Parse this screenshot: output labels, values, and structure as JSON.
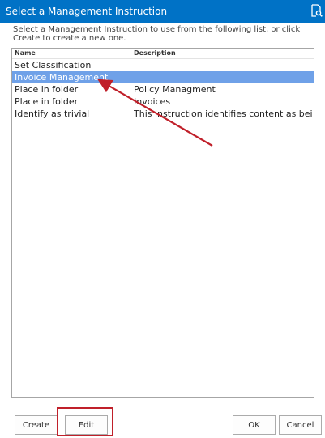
{
  "dialog": {
    "title": "Select a Management Instruction",
    "instruction": "Select a Management Instruction to use from the following list, or click Create to create a new one."
  },
  "list": {
    "columns": [
      "Name",
      "Description"
    ],
    "rows": [
      {
        "name": "Set Classification",
        "description": "",
        "selected": false
      },
      {
        "name": "Invoice Management",
        "description": "",
        "selected": true
      },
      {
        "name": "Place in folder",
        "description": "Policy Managment",
        "selected": false
      },
      {
        "name": "Place in folder",
        "description": "Invoices",
        "selected": false
      },
      {
        "name": "Identify as trivial",
        "description": "This instruction identifies content as being ...",
        "selected": false
      }
    ]
  },
  "buttons": {
    "create": "Create",
    "edit": "Edit",
    "ok": "OK",
    "cancel": "Cancel"
  },
  "colors": {
    "titlebar": "#0072c6",
    "selection": "#6fa1e8",
    "annotation": "#c0202a"
  },
  "icons": {
    "titlebar": "document-search-icon"
  }
}
